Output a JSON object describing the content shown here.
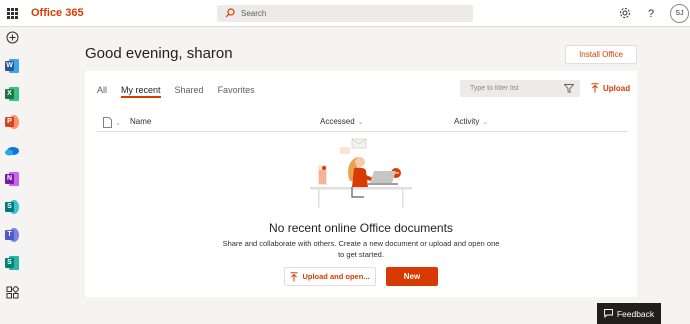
{
  "topbar": {
    "brand": "Office 365",
    "search_placeholder": "Search",
    "avatar_initials": "SJ"
  },
  "rail": {
    "apps": [
      {
        "name": "create",
        "color": "#323130"
      },
      {
        "name": "word",
        "letter": "W",
        "color": "#2b579a"
      },
      {
        "name": "excel",
        "letter": "X",
        "color": "#217346"
      },
      {
        "name": "powerpoint",
        "letter": "P",
        "color": "#d24726"
      },
      {
        "name": "onedrive",
        "color": "#0f78d4"
      },
      {
        "name": "onenote",
        "letter": "N",
        "color": "#7719aa"
      },
      {
        "name": "sharepoint",
        "letter": "S",
        "color": "#03787c"
      },
      {
        "name": "teams",
        "letter": "T",
        "color": "#5059c9"
      },
      {
        "name": "sway",
        "letter": "S",
        "color": "#008272"
      },
      {
        "name": "all-apps",
        "color": "#323130"
      }
    ]
  },
  "main": {
    "greeting": "Good evening, sharon",
    "install_label": "Install Office",
    "tabs": [
      {
        "label": "All",
        "active": false
      },
      {
        "label": "My recent",
        "active": true
      },
      {
        "label": "Shared",
        "active": false
      },
      {
        "label": "Favorites",
        "active": false
      }
    ],
    "filter_placeholder": "Type to filter list",
    "upload_label": "Upload",
    "columns": {
      "name": "Name",
      "accessed": "Accessed",
      "activity": "Activity"
    },
    "empty": {
      "title": "No recent online Office documents",
      "subtitle": "Share and collaborate with others. Create a new document or upload and open one to get started.",
      "upload_open_label": "Upload and open...",
      "new_label": "New"
    }
  },
  "feedback_label": "Feedback",
  "colors": {
    "accent": "#d83b01",
    "background": "#f5f4f3",
    "card": "#ffffff"
  }
}
